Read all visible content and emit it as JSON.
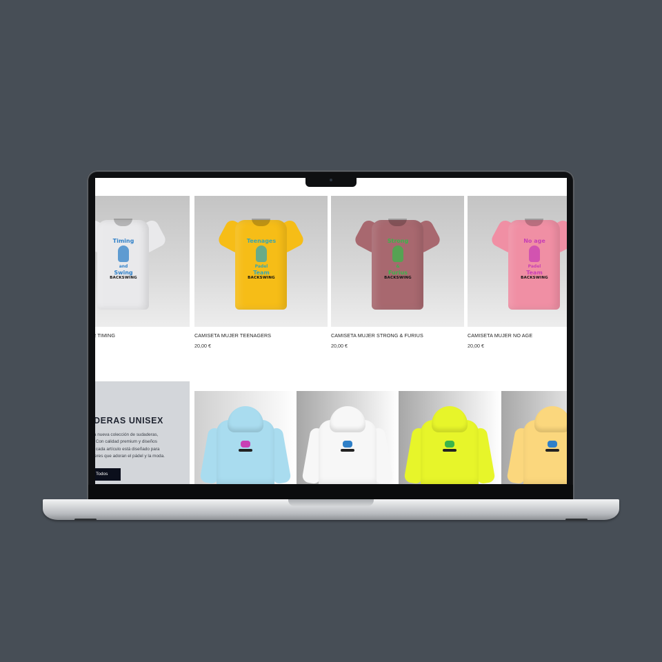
{
  "colors": {
    "page_background": "#474e56",
    "promo_background": "#d3d6da",
    "button_background": "#0b0f1c"
  },
  "products": [
    {
      "name": "CAMISETA MUJER TIMING",
      "name_visible": "R TIMING",
      "price": "",
      "shirt_color": "#e9e9eb",
      "print_text": [
        "Timing",
        "and",
        "Swing"
      ],
      "print_color": "#2f80c8",
      "brand": "BACKSWING"
    },
    {
      "name": "CAMISETA MUJER TEENAGERS",
      "price": "20,00 €",
      "shirt_color": "#f6bd17",
      "print_text": [
        "Teenages",
        "Padel",
        "Team"
      ],
      "print_color": "#3aa6b0",
      "brand": "BACKSWING"
    },
    {
      "name": "CAMISETA MUJER STRONG & FURIUS",
      "price": "20,00 €",
      "shirt_color": "#a8686f",
      "print_text": [
        "Strong",
        "&",
        "Furius"
      ],
      "print_color": "#3bb54a",
      "brand": "BACKSWING"
    },
    {
      "name": "CAMISETA MUJER NO AGE",
      "price": "20,00 €",
      "shirt_color": "#f08fa4",
      "print_text": [
        "No age",
        "Padel",
        "Team"
      ],
      "print_color": "#c83fb4",
      "brand": "BACKSWING"
    }
  ],
  "promo": {
    "title": "DERAS UNISEX",
    "description_lines": [
      "tra nueva colección de sudaderas,",
      "s. Con calidad premium y diseños",
      "s, cada artículo está diseñado para",
      "ujeres que adoran el pádel y la moda."
    ],
    "button_label": "Todos"
  },
  "hoodies": [
    {
      "color": "#a9dcef",
      "bg": [
        "#cfcfcf",
        "#ffffff"
      ],
      "print_color": "#c83fb4"
    },
    {
      "color": "#f7f7f7",
      "bg": [
        "#a7a7a7",
        "#ffffff"
      ],
      "print_color": "#2f80c8"
    },
    {
      "color": "#e7f52a",
      "bg": [
        "#a7a7a7",
        "#ffffff"
      ],
      "print_color": "#3bb54a"
    },
    {
      "color": "#fbd77d",
      "bg": [
        "#a7a7a7",
        "#ffffff"
      ],
      "print_color": "#2f80c8"
    }
  ]
}
